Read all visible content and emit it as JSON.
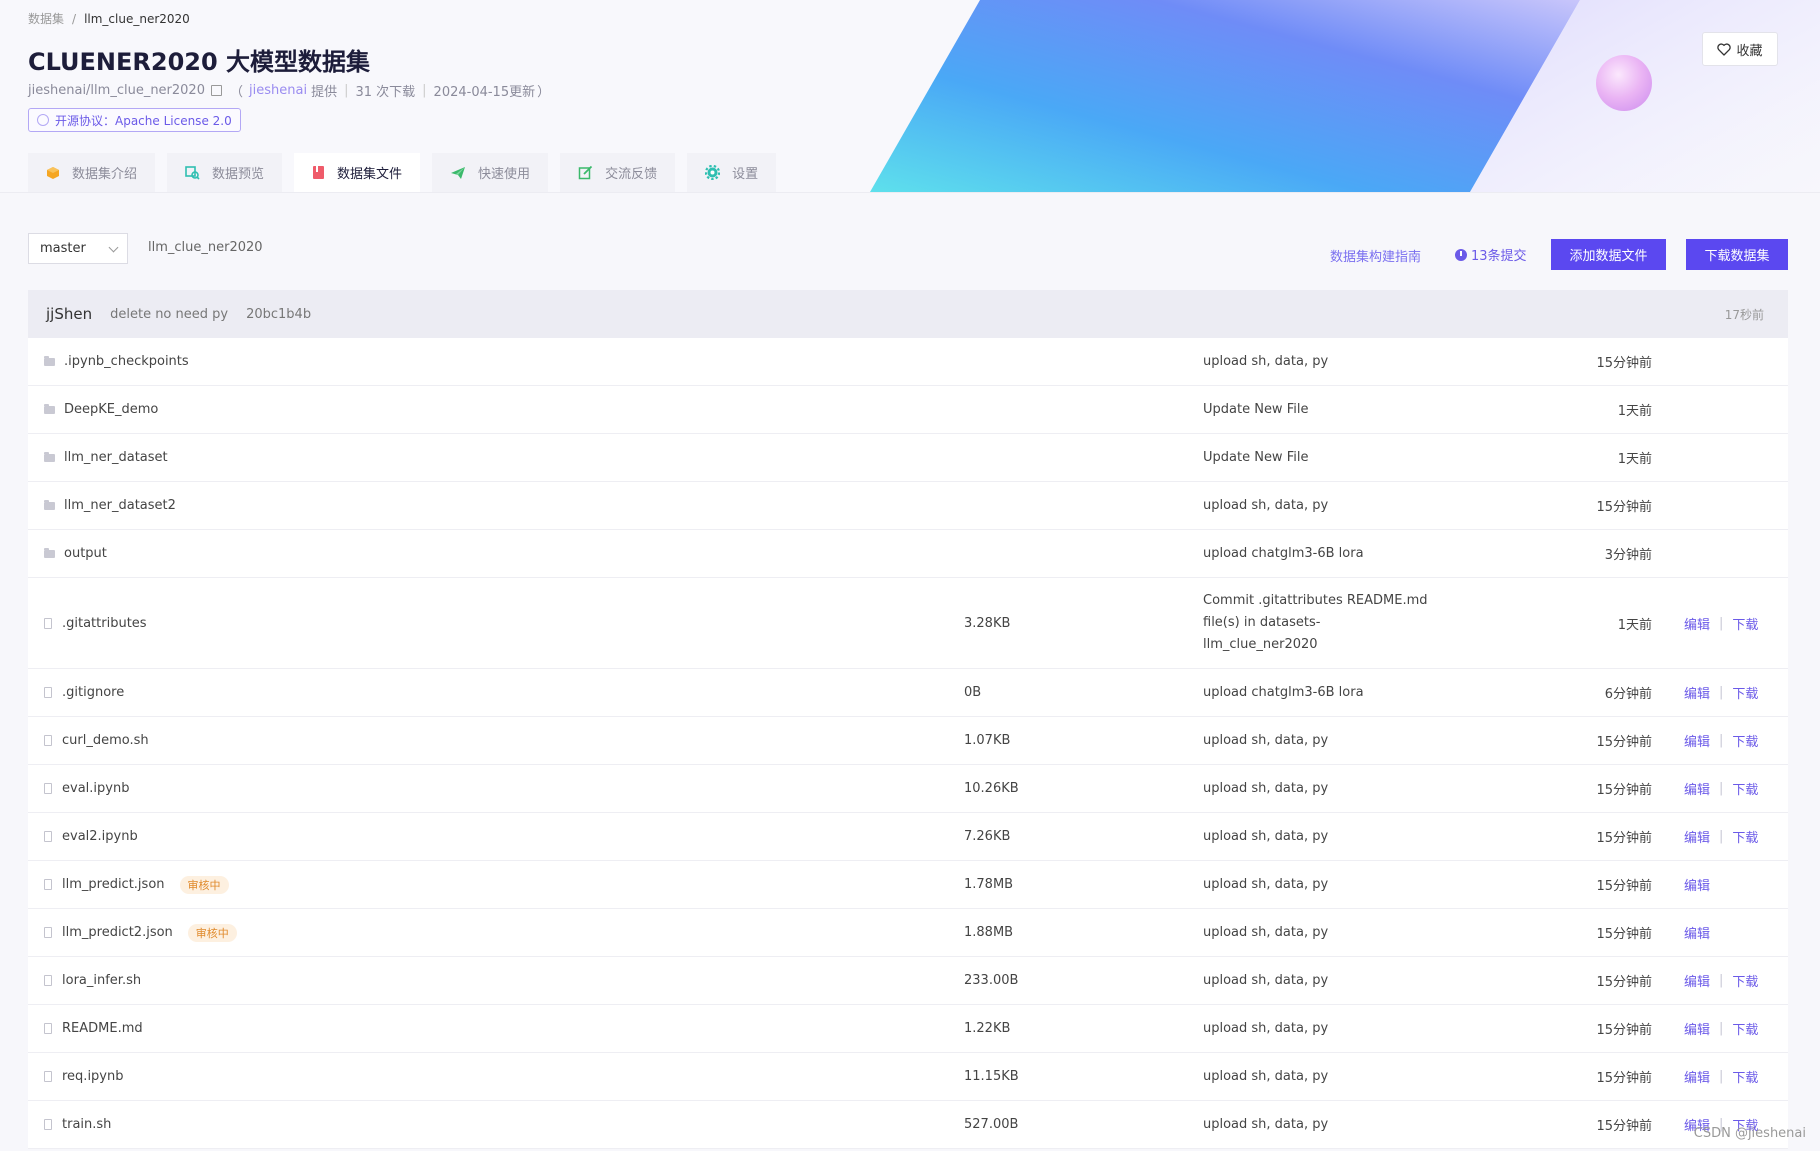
{
  "breadcrumb": {
    "root": "数据集",
    "sep": "/",
    "current": "llm_clue_ner2020"
  },
  "title": "CLUENER2020 大模型数据集",
  "meta": {
    "repo": "jieshenai/llm_clue_ner2020",
    "open_paren": "（",
    "provider": "jieshenai",
    "provided": "提供",
    "divider": "|",
    "downloads": "31 次下载",
    "updated": "2024-04-15更新",
    "close_paren": "）"
  },
  "license": "开源协议：Apache License 2.0",
  "favorite_label": "收藏",
  "tabs": [
    {
      "label": "数据集介绍",
      "icon": "box-icon"
    },
    {
      "label": "数据预览",
      "icon": "preview-icon"
    },
    {
      "label": "数据集文件",
      "icon": "book-icon"
    },
    {
      "label": "快速使用",
      "icon": "send-icon"
    },
    {
      "label": "交流反馈",
      "icon": "edit-icon"
    },
    {
      "label": "设置",
      "icon": "gear-icon"
    }
  ],
  "active_tab": "数据集文件",
  "toolbar": {
    "branch": "master",
    "path": "llm_clue_ner2020",
    "guide": "数据集构建指南",
    "commits": "13条提交",
    "add_button": "添加数据文件",
    "download_button": "下载数据集"
  },
  "latest_commit": {
    "author": "jjShen",
    "message": "delete no need py",
    "hash": "20bc1b4b",
    "time": "17秒前"
  },
  "ops": {
    "edit": "编辑",
    "download": "下载",
    "sep": "|"
  },
  "files": [
    {
      "name": ".ipynb_checkpoints",
      "type": "folder",
      "size": "",
      "commit": "upload sh, data, py",
      "time": "15分钟前"
    },
    {
      "name": "DeepKE_demo",
      "type": "folder",
      "size": "",
      "commit": "Update New File",
      "time": "1天前"
    },
    {
      "name": "llm_ner_dataset",
      "type": "folder",
      "size": "",
      "commit": "Update New File",
      "time": "1天前"
    },
    {
      "name": "llm_ner_dataset2",
      "type": "folder",
      "size": "",
      "commit": "upload sh, data, py",
      "time": "15分钟前"
    },
    {
      "name": "output",
      "type": "folder",
      "size": "",
      "commit": "upload chatglm3-6B lora",
      "time": "3分钟前"
    },
    {
      "name": ".gitattributes",
      "type": "file",
      "size": "3.28KB",
      "commit": "Commit .gitattributes README.md file(s) in datasets-llm_clue_ner2020",
      "time": "1天前",
      "edit": true,
      "download": true
    },
    {
      "name": ".gitignore",
      "type": "file",
      "size": "0B",
      "commit": "upload chatglm3-6B lora",
      "time": "6分钟前",
      "edit": true,
      "download": true
    },
    {
      "name": "curl_demo.sh",
      "type": "file",
      "size": "1.07KB",
      "commit": "upload sh, data, py",
      "time": "15分钟前",
      "edit": true,
      "download": true
    },
    {
      "name": "eval.ipynb",
      "type": "file",
      "size": "10.26KB",
      "commit": "upload sh, data, py",
      "time": "15分钟前",
      "edit": true,
      "download": true
    },
    {
      "name": "eval2.ipynb",
      "type": "file",
      "size": "7.26KB",
      "commit": "upload sh, data, py",
      "time": "15分钟前",
      "edit": true,
      "download": true
    },
    {
      "name": "llm_predict.json",
      "type": "file",
      "badge": "审核中",
      "size": "1.78MB",
      "commit": "upload sh, data, py",
      "time": "15分钟前",
      "edit": true,
      "download": false
    },
    {
      "name": "llm_predict2.json",
      "type": "file",
      "badge": "审核中",
      "size": "1.88MB",
      "commit": "upload sh, data, py",
      "time": "15分钟前",
      "edit": true,
      "download": false
    },
    {
      "name": "lora_infer.sh",
      "type": "file",
      "size": "233.00B",
      "commit": "upload sh, data, py",
      "time": "15分钟前",
      "edit": true,
      "download": true
    },
    {
      "name": "README.md",
      "type": "file",
      "size": "1.22KB",
      "commit": "upload sh, data, py",
      "time": "15分钟前",
      "edit": true,
      "download": true
    },
    {
      "name": "req.ipynb",
      "type": "file",
      "size": "11.15KB",
      "commit": "upload sh, data, py",
      "time": "15分钟前",
      "edit": true,
      "download": true
    },
    {
      "name": "train.sh",
      "type": "file",
      "size": "527.00B",
      "commit": "upload sh, data, py",
      "time": "15分钟前",
      "edit": true,
      "download": true
    }
  ],
  "watermark": "CSDN @jieshenai",
  "colors": {
    "accent": "#5b48f0",
    "link": "#6b5ae8",
    "badge_bg": "#fdf0e0",
    "badge_text": "#e08a2c"
  }
}
